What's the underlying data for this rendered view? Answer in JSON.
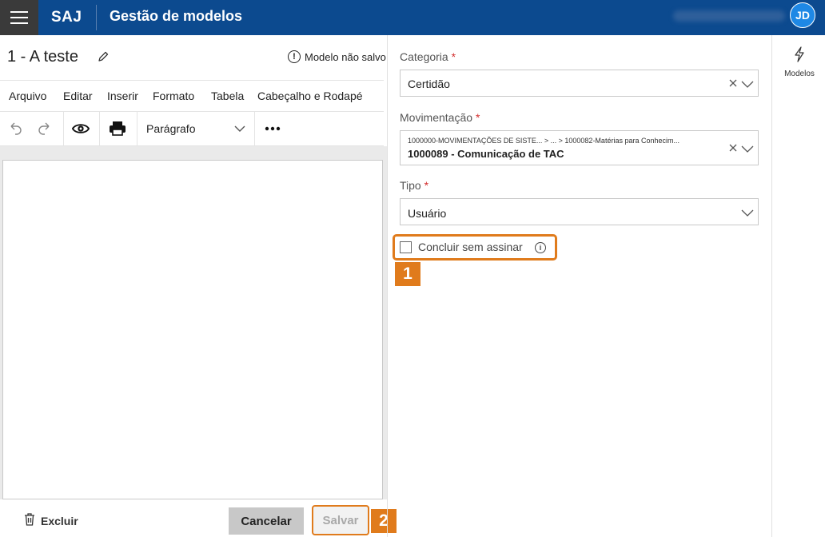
{
  "header": {
    "brand": "SAJ",
    "title": "Gestão de modelos",
    "avatar_initials": "JD",
    "bar_color": "#0c4a8f"
  },
  "document": {
    "title": "1 - A teste",
    "unsaved_label": "Modelo não salvo"
  },
  "menubar": {
    "items": [
      "Arquivo",
      "Editar",
      "Inserir",
      "Formato",
      "Tabela",
      "Cabeçalho e Rodapé"
    ]
  },
  "toolbar": {
    "block_format": "Parágrafo",
    "icons": [
      "undo-icon",
      "redo-icon",
      "preview-eye-icon",
      "print-icon",
      "more-icon"
    ]
  },
  "footer": {
    "delete_label": "Excluir",
    "cancel_label": "Cancelar",
    "save_label": "Salvar",
    "save_badge": "2"
  },
  "form": {
    "categoria": {
      "label": "Categoria",
      "required": "*",
      "value": "Certidão"
    },
    "movimentacao": {
      "label": "Movimentação",
      "required": "*",
      "path": "1000000-MOVIMENTAÇÕES DE SISTE... > ... > 1000082-Matérias para Conhecim...",
      "value": "1000089 - Comunicação de TAC"
    },
    "tipo": {
      "label": "Tipo",
      "required": "*",
      "value": "Usuário"
    },
    "concluir": {
      "label": "Concluir sem assinar",
      "checked": false,
      "badge": "1"
    }
  },
  "sidebar": {
    "models_label": "Modelos"
  },
  "colors": {
    "accent_orange": "#e07b1c",
    "required_red": "#d32f2f"
  }
}
